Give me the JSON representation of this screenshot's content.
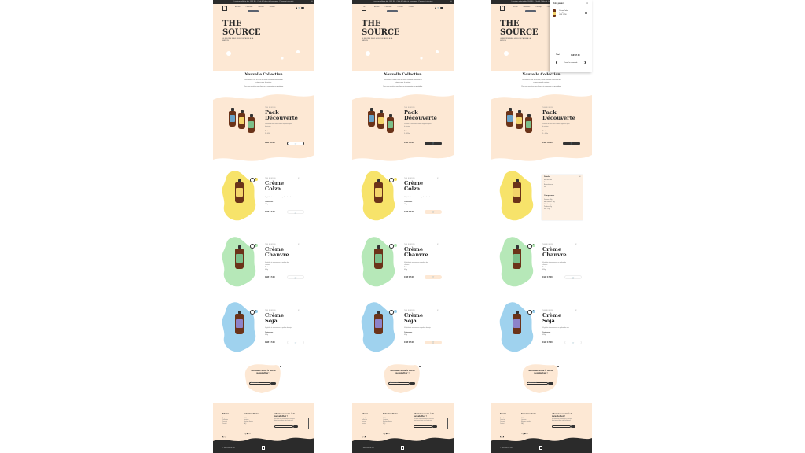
{
  "topbar_text": "Livraison offerte dès CHF 80 · Click & Collect à Lausanne · Paiement sécurisé",
  "topbar_close": "✕",
  "nav": {
    "logo": "TS",
    "items": [
      "Accueil",
      "Collection",
      "Concept",
      "Contact"
    ],
    "cart_count": "0",
    "user_icon": "user-icon",
    "cart_icon": "cart-icon"
  },
  "hero": {
    "title": "THE SOURCE",
    "subtitle": "LE BEURRE SANS HUILE DE PALME À LA MAISON"
  },
  "collection": {
    "title": "Nouvelle Collection",
    "text": "Découvrez THE SOURCE, notre nouvelle collection de crèmes pour la cuisine.",
    "text2": "Pour vos recettes sans beurre ni margarine au quotidien."
  },
  "products": [
    {
      "category": "THE SOURCE",
      "title": "Pack Découverte",
      "desc": "Profitez de nos trois crèmes végétales pour la cuisine",
      "qty_label": "Contenance",
      "qty": "3 × 450g",
      "price": "CHF 45.00"
    },
    {
      "category": "THE SOURCE",
      "title": "Crème Colza",
      "desc": "Végétale et savoureuse au parfum de colza",
      "qty_label": "Contenance",
      "qty": "450g",
      "price": "CHF 17.00"
    },
    {
      "category": "THE SOURCE",
      "title": "Crème Chanvre",
      "desc": "Végétale et savoureuse au parfum de chanvre",
      "qty_label": "Contenance",
      "qty": "450g",
      "price": "CHF 17.00"
    },
    {
      "category": "THE SOURCE",
      "title": "Crème Soja",
      "desc": "Végétale et savoureuse au parfum de soja",
      "qty_label": "Contenance",
      "qty": "450g",
      "price": "CHF 17.00"
    }
  ],
  "cart_glyph": "🛒",
  "share_label": "Partager",
  "newsletter": {
    "title": "Abonnez-vous à notre newsletter !",
    "placeholder": "Adresse e-mail"
  },
  "footer": {
    "col1": "Menu",
    "col1_items": [
      "Accueil",
      "Collection",
      "Concept",
      "Contact"
    ],
    "col2": "Informations",
    "col2_items": [
      "CGV",
      "Livraison",
      "Mentions légales",
      "FAQ"
    ],
    "col3": "Abonnez-vous à la newsletter !",
    "col3_text": "Recevez nos nouveautés et recettes directement dans votre boîte mail.",
    "socials": "f ◎ ▶ in",
    "copyright": "© THE SOURCE 2021"
  },
  "cart_drawer": {
    "title": "Votre panier",
    "close": "✕",
    "item": "Crème Colza",
    "item_qty": "1 × 450g",
    "item_price": "CHF 17.00",
    "total_label": "Total",
    "total_value": "CHF 17.00",
    "checkout": "Passer la commande"
  },
  "details": {
    "close": "✕",
    "h1": "Détails",
    "lines1": [
      "Huile de colza",
      "Eau",
      "Beurre de cacao",
      "Sel"
    ],
    "h2": "Composants",
    "lines2": [
      "Graisses : 80g",
      "dont saturées : 18g",
      "Glucides : 0g",
      "Protéines : 0g",
      "Sel : 1.2g"
    ]
  },
  "colors": {
    "peach": "#fde8d4",
    "dark": "#2b2b2b",
    "colza": "#f7e36a",
    "chanvre": "#b6e8b8",
    "soja": "#9fd2ee"
  }
}
